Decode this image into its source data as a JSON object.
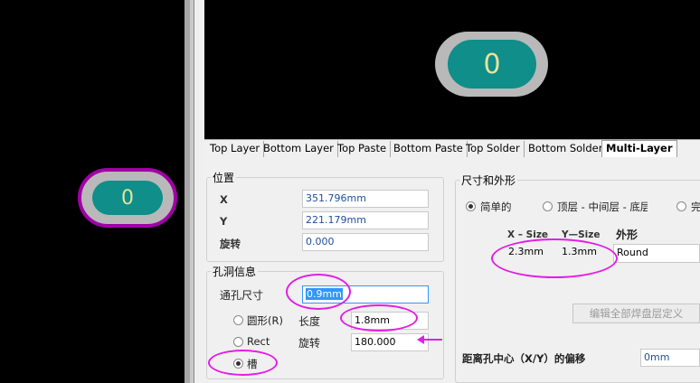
{
  "pcb": {
    "pad_label": "0"
  },
  "preview": {
    "pad_label": "0"
  },
  "tabs": [
    "Top Layer",
    "Bottom Layer",
    "Top Paste",
    "Bottom Paste",
    "Top Solder",
    "Bottom Solder",
    "Multi-Layer"
  ],
  "active_tab": "Multi-Layer",
  "location": {
    "title": "位置",
    "x_label": "X",
    "x_value": "351.796mm",
    "y_label": "Y",
    "y_value": "221.179mm",
    "rotation_label": "旋转",
    "rotation_value": "0.000"
  },
  "hole": {
    "title": "孔洞信息",
    "size_label": "通孔尺寸",
    "size_value": "0.9mm",
    "round_label": "圆形(R)",
    "rect_label": "Rect",
    "slot_label": "槽",
    "length_label": "长度",
    "length_value": "1.8mm",
    "rotation_label": "旋转",
    "rotation_value": "180.000",
    "selected": "槽"
  },
  "size_shape": {
    "title": "尺寸和外形",
    "simple_label": "简单的",
    "tmb_label": "顶层 - 中间层 - 底层",
    "full_label": "完",
    "col_xsize": "X – Size",
    "col_ysize": "Y—Size",
    "col_shape": "外形",
    "x_size": "2.3mm",
    "y_size": "1.3mm",
    "shape": "Round",
    "edit_button": "编辑全部焊盘层定义",
    "offset_label": "距离孔中心（X/Y）的偏移",
    "offset_value": "0mm"
  },
  "annotation_color": "#e41ce6"
}
